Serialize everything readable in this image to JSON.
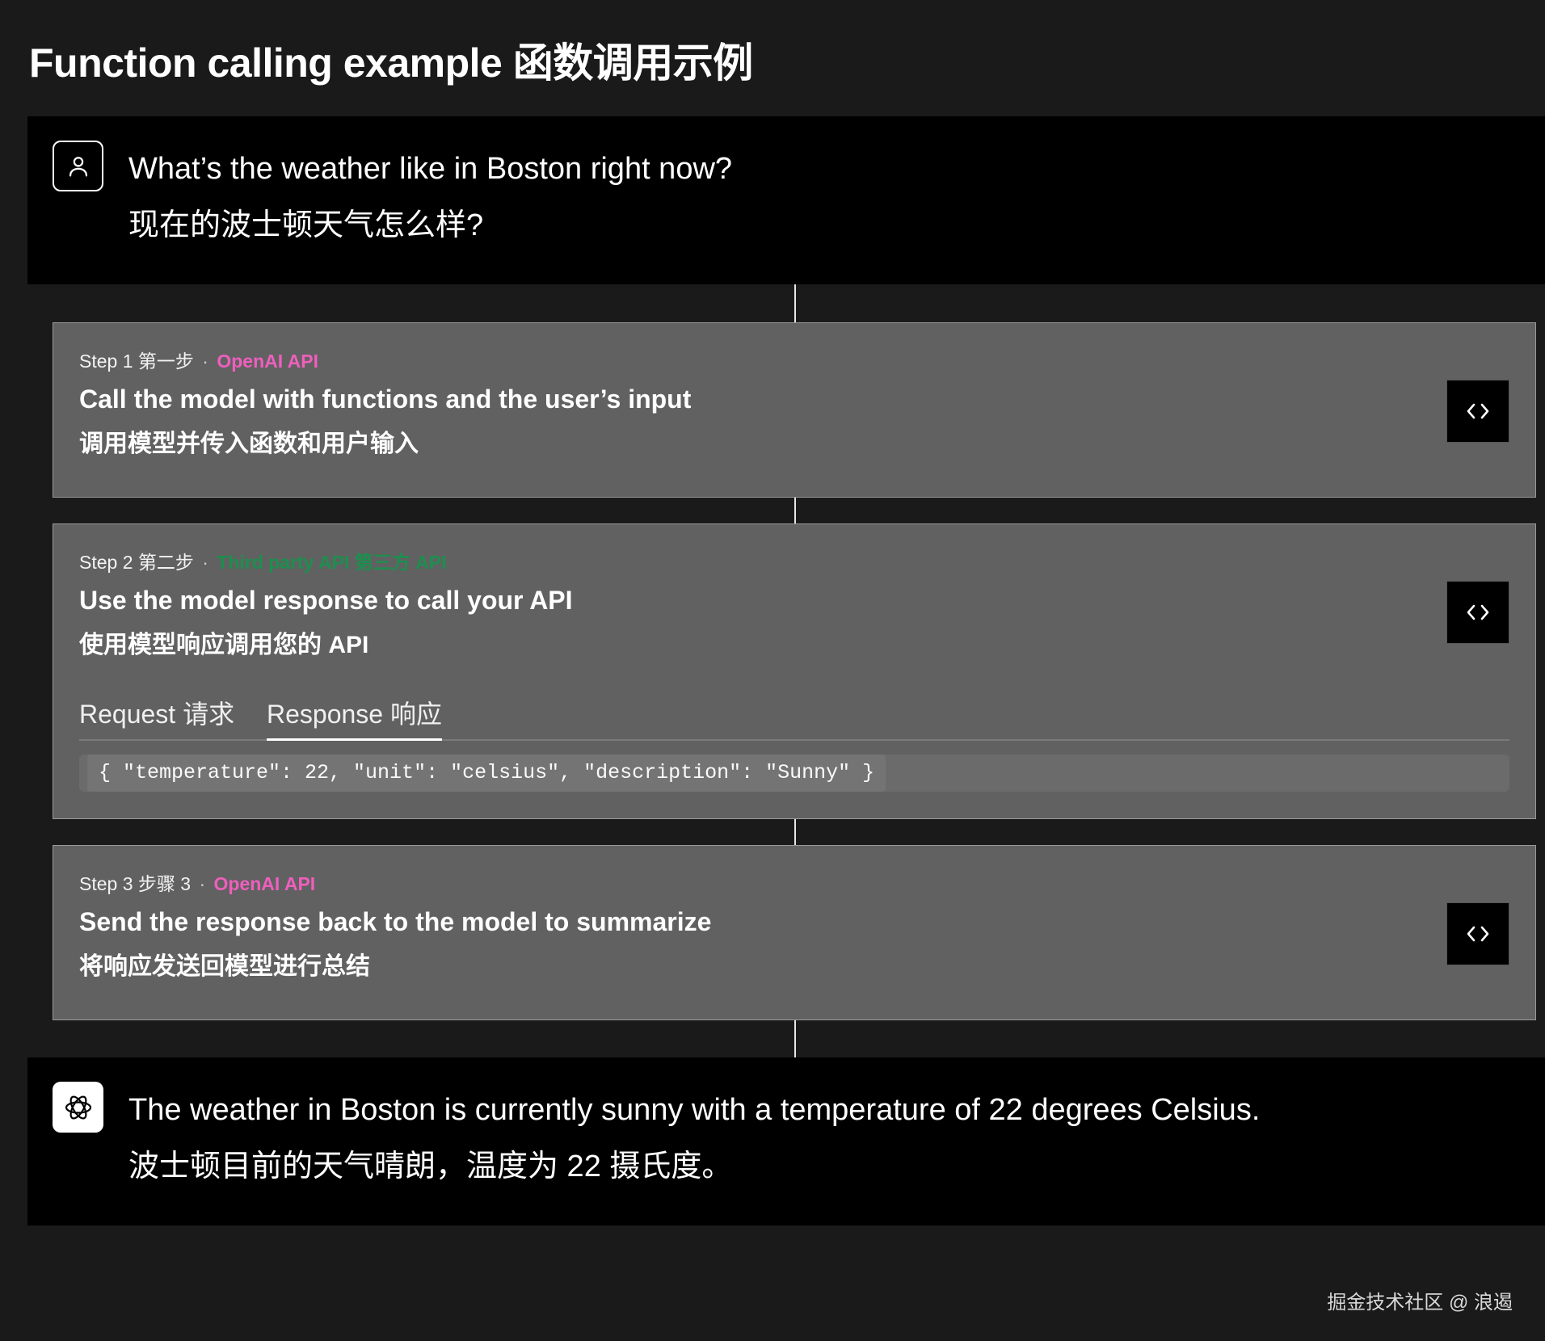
{
  "header": {
    "title": "Function calling example  函数调用示例"
  },
  "user_message": {
    "icon": "user-icon",
    "text_en": "What’s the weather like in Boston right now?",
    "text_zh": "现在的波士顿天气怎么样?"
  },
  "steps": [
    {
      "label": "Step 1  第一步",
      "separator": "·",
      "tag": "OpenAI API",
      "tag_color": "#ef5fbd",
      "title": "Call the model with functions and the user’s input",
      "subtitle": "调用模型并传入函数和用户输入",
      "code_icon": "code-brackets-icon"
    },
    {
      "label": "Step 2  第二步",
      "separator": "·",
      "tag": "Third party API  第三方 API",
      "tag_color": "#1c8f4f",
      "title": "Use the model response to call your API",
      "subtitle": "使用模型响应调用您的 API",
      "code_icon": "code-brackets-icon",
      "tabs": [
        "Request  请求",
        "Response  响应"
      ],
      "active_tab": "Response  响应",
      "code": "{ \"temperature\": 22, \"unit\": \"celsius\", \"description\": \"Sunny\" }"
    },
    {
      "label": "Step 3  步骤 3",
      "separator": "·",
      "tag": "OpenAI API",
      "tag_color": "#ef5fbd",
      "title": "Send the response back to the model to summarize",
      "subtitle": "将响应发送回模型进行总结",
      "code_icon": "code-brackets-icon"
    }
  ],
  "assistant_message": {
    "icon": "openai-logo-icon",
    "text_en": "The weather in Boston is currently sunny with a temperature of 22 degrees Celsius.",
    "text_zh": "波士顿目前的天气晴朗，温度为 22 摄氏度。"
  },
  "watermark": "掘金技术社区 @ 浪遏"
}
